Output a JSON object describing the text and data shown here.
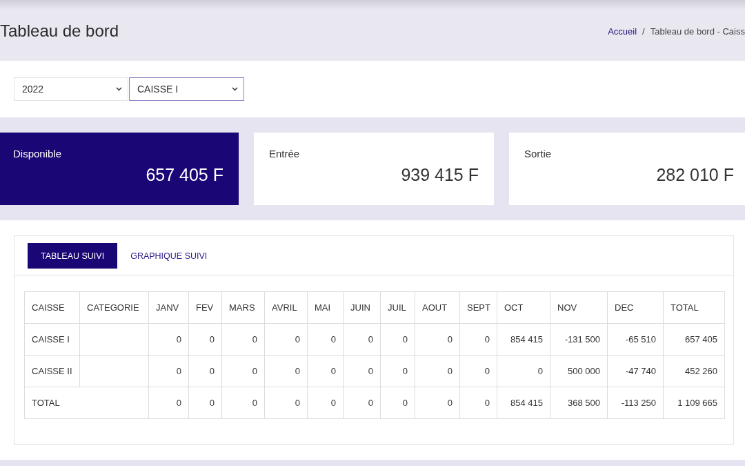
{
  "header": {
    "title": "Tableau de bord",
    "breadcrumb": [
      {
        "label": "Accueil",
        "kind": "link"
      },
      {
        "label": "Tableau de bord - Caiss",
        "kind": "current"
      }
    ],
    "separator": "/"
  },
  "filters": [
    {
      "value": "2022",
      "focused": false
    },
    {
      "value": "CAISSE I",
      "focused": true
    }
  ],
  "stats": [
    {
      "label": "Disponible",
      "value": "657 405 F",
      "highlighted": true
    },
    {
      "label": "Entrée",
      "value": "939 415 F",
      "highlighted": false
    },
    {
      "label": "Sortie",
      "value": "282 010 F",
      "highlighted": false
    }
  ],
  "tabs": [
    {
      "label": "TABLEAU SUIVI",
      "selected": true
    },
    {
      "label": "GRAPHIQUE SUIVI",
      "selected": false
    }
  ],
  "table": {
    "columns": [
      "CAISSE",
      "CATEGORIE",
      "JANV",
      "FEV",
      "MARS",
      "AVRIL",
      "MAI",
      "JUIN",
      "JUIL",
      "AOUT",
      "SEPT",
      "OCT",
      "NOV",
      "DEC",
      "TOTAL"
    ],
    "rows": [
      {
        "kind": "data",
        "caisse": "CAISSE I",
        "values": [
          "0",
          "0",
          "0",
          "0",
          "0",
          "0",
          "0",
          "0",
          "0",
          "854 415",
          "-131 500",
          "-65 510",
          "657 405"
        ]
      },
      {
        "kind": "data",
        "caisse": "CAISSE II",
        "values": [
          "0",
          "0",
          "0",
          "0",
          "0",
          "0",
          "0",
          "0",
          "0",
          "0",
          "500 000",
          "-47 740",
          "452 260"
        ]
      },
      {
        "kind": "total",
        "caisse": "TOTAL",
        "values": [
          "0",
          "0",
          "0",
          "0",
          "0",
          "0",
          "0",
          "0",
          "0",
          "854 415",
          "368 500",
          "-113 250",
          "1 109 665"
        ]
      }
    ]
  }
}
